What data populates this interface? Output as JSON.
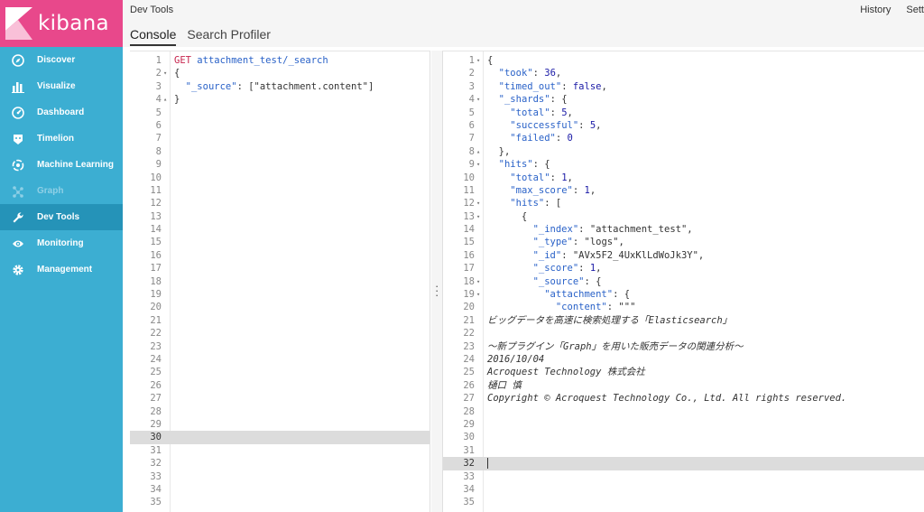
{
  "app": {
    "brand": "kibana"
  },
  "sidebar": {
    "items": [
      {
        "label": "Discover",
        "icon": "compass-icon"
      },
      {
        "label": "Visualize",
        "icon": "bar-chart-icon"
      },
      {
        "label": "Dashboard",
        "icon": "gauge-icon"
      },
      {
        "label": "Timelion",
        "icon": "timelion-icon"
      },
      {
        "label": "Machine Learning",
        "icon": "machine-learning-icon"
      },
      {
        "label": "Graph",
        "icon": "graph-icon"
      },
      {
        "label": "Dev Tools",
        "icon": "wrench-icon"
      },
      {
        "label": "Monitoring",
        "icon": "eye-icon"
      },
      {
        "label": "Management",
        "icon": "gear-icon"
      }
    ]
  },
  "header": {
    "title": "Dev Tools",
    "history": "History",
    "settings": "Sett",
    "tabs": [
      "Console",
      "Search Profiler"
    ]
  },
  "request": {
    "method": "GET",
    "path": "attachment_test/_search",
    "line2": "{",
    "source_key": "\"_source\"",
    "source_val": "[\"attachment.content\"]",
    "line4": "}"
  },
  "response": {
    "took": "36",
    "timed_out": "false",
    "shards_total": "5",
    "shards_successful": "5",
    "shards_failed": "0",
    "hits_total": "1",
    "max_score": "1",
    "index": "\"attachment_test\"",
    "type": "\"logs\"",
    "id": "\"AVx5F2_4UxKlLdWoJk3Y\"",
    "score": "1",
    "content_open": "\"\"\"",
    "text_lines": [
      "ビッグデータを高速に検索処理する「Elasticsearch」",
      "",
      "～新プラグイン「Graph」を用いた販売データの関連分析～",
      "2016/10/04",
      "Acroquest Technology 株式会社",
      "樋口 慎",
      "Copyright © Acroquest Technology Co., Ltd. All rights reserved."
    ]
  },
  "colors": {
    "sidebar": "#3caed2",
    "brand": "#e8488b",
    "active": "#2593b8"
  }
}
